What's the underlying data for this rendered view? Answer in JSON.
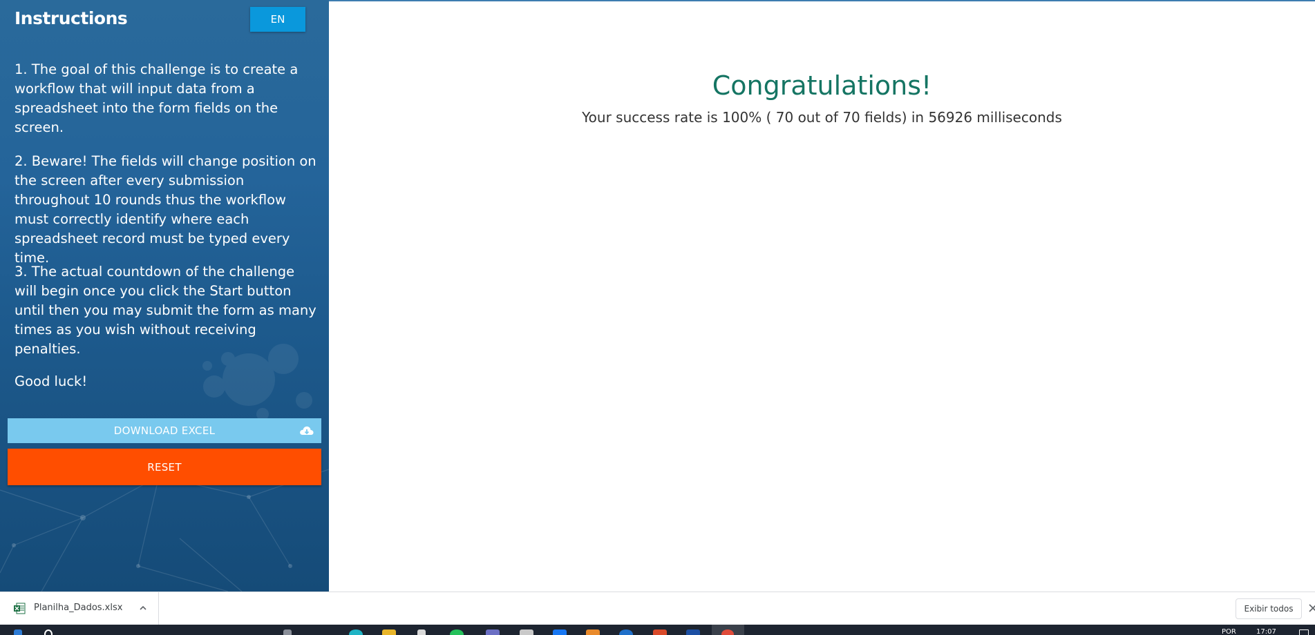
{
  "sidebar": {
    "title": "Instructions",
    "language_button": "EN",
    "paragraphs": [
      "1. The goal of this challenge is to create a workflow that will input data from a spreadsheet into the form fields on the screen.",
      "2. Beware! The fields will change position on the screen after every submission throughout 10 rounds thus the workflow must correctly identify where each spreadsheet record must be typed every time.",
      "3. The actual countdown of the challenge will begin once you click the Start button until then you may submit the form as many times as you wish without receiving penalties.",
      "Good luck!"
    ],
    "download_button": "DOWNLOAD EXCEL",
    "download_icon": "cloud-download-icon",
    "reset_button": "RESET"
  },
  "main": {
    "heading": "Congratulations!",
    "result_text": "Your success rate is 100% ( 70 out of 70 fields) in 56926 milliseconds"
  },
  "downloads_bar": {
    "file_name": "Planilha_Dados.xlsx",
    "file_icon": "excel-file-icon",
    "show_all_button": "Exibir todos"
  },
  "taskbar": {
    "language": "POR",
    "time": "17:07"
  },
  "colors": {
    "sidebar_bg": "#1f5d8f",
    "language_button": "#0a98dc",
    "download_button": "#79c9ee",
    "reset_button": "#ff4e00",
    "heading": "#157563"
  }
}
